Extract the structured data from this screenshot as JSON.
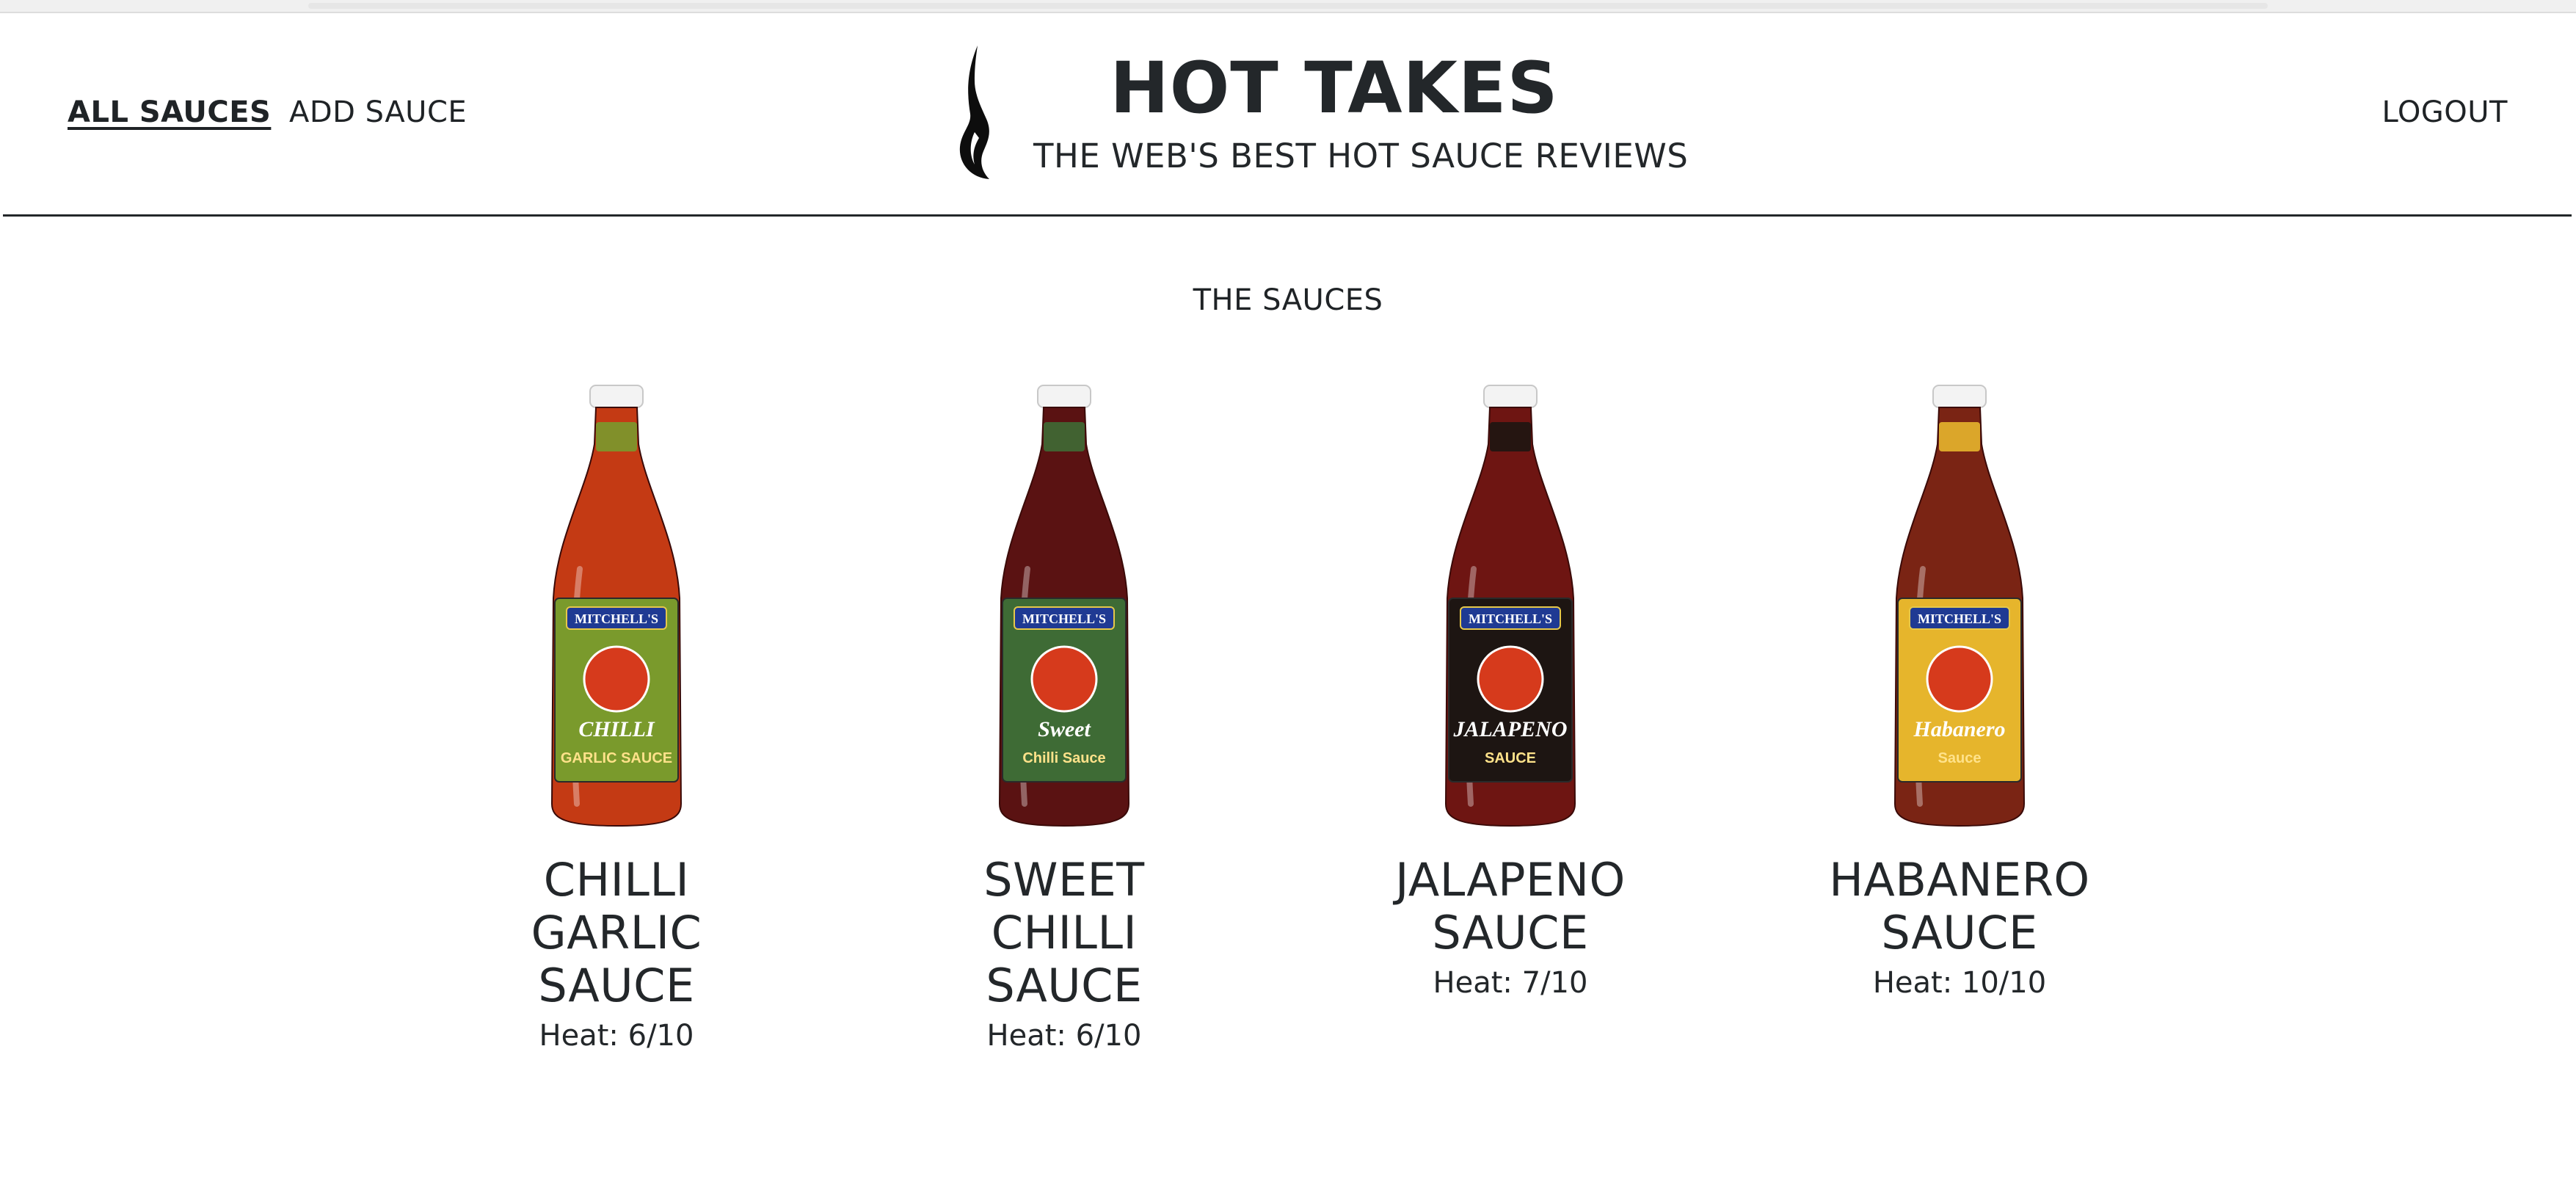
{
  "nav": {
    "all_sauces": "ALL SAUCES",
    "add_sauce": "ADD SAUCE",
    "logout": "LOGOUT"
  },
  "header": {
    "title": "HOT TAKES",
    "tagline": "THE WEB'S BEST HOT SAUCE REVIEWS",
    "logo_icon": "flame-icon"
  },
  "main": {
    "section_title": "THE SAUCES",
    "sauces": [
      {
        "name": "CHILLI GARLIC SAUCE",
        "heat": "Heat: 6/10",
        "brand": "MITCHELL'S",
        "label_text": "CHILLI",
        "label_sub": "GARLIC SAUCE",
        "sauce_color": "#c43a14",
        "label_color": "#7a9a2c"
      },
      {
        "name": "SWEET CHILLI SAUCE",
        "heat": "Heat: 6/10",
        "brand": "MITCHELL'S",
        "label_text": "Sweet",
        "label_sub": "Chilli Sauce",
        "sauce_color": "#5a1212",
        "label_color": "#3e6b35"
      },
      {
        "name": "JALAPENO SAUCE",
        "heat": "Heat: 7/10",
        "brand": "MITCHELL'S",
        "label_text": "JALAPENO",
        "label_sub": "SAUCE",
        "sauce_color": "#6e1512",
        "label_color": "#1d1512"
      },
      {
        "name": "HABANERO SAUCE",
        "heat": "Heat: 10/10",
        "brand": "MITCHELL'S",
        "label_text": "Habanero",
        "label_sub": "Sauce",
        "sauce_color": "#7a2414",
        "label_color": "#e6b52c"
      }
    ]
  }
}
